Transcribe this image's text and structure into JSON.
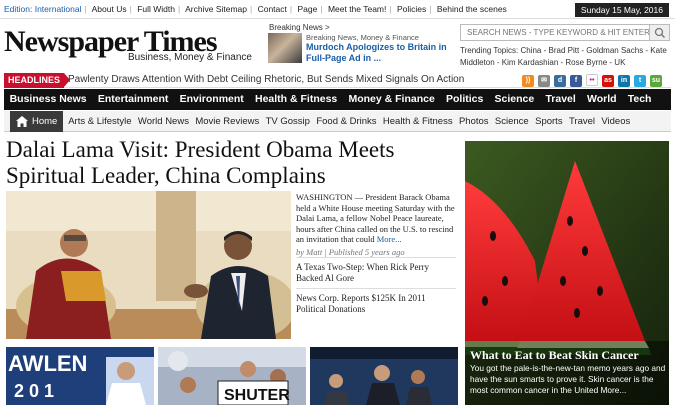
{
  "topbar": {
    "edition": "Edition: International",
    "links": [
      "About Us",
      "Full Width",
      "Archive Sitemap",
      "Contact",
      "Page",
      "Meet the Team!",
      "Policies",
      "Behind the scenes"
    ],
    "date": "Sunday 15 May, 2016"
  },
  "brand": {
    "logo": "Newspaper Times",
    "tagline": "Business, Money & Finance"
  },
  "breaking": {
    "label": "Breaking News >",
    "categories": "Breaking News, Money & Finance",
    "title": "Murdoch Apologizes to Britain in Full-Page Ad in ..."
  },
  "search": {
    "placeholder": "SEARCH NEWS - TYPE KEYWORD & HIT ENTER"
  },
  "trending": {
    "text": "Trending Topics: China - Brad Pitt - Goldman Sachs - Kate Middleton - Kim Kardashian - Rose Byrne - UK"
  },
  "ticker": {
    "label": "HEADLINES",
    "text": "Pawlenty Draws Attention With Debt Ceiling Rhetoric, But Sends Mixed Signals On Action"
  },
  "social": [
    {
      "icon": "rss-icon",
      "glyph": "))",
      "color": "#f08a24"
    },
    {
      "icon": "mail-icon",
      "glyph": "✉",
      "color": "#888888"
    },
    {
      "icon": "digg-icon",
      "glyph": "d",
      "color": "#3b6d9a"
    },
    {
      "icon": "facebook-icon",
      "glyph": "f",
      "color": "#3b5998"
    },
    {
      "icon": "flickr-icon",
      "glyph": "••",
      "color": "#ffffff"
    },
    {
      "icon": "lastfm-icon",
      "glyph": "as",
      "color": "#d51007"
    },
    {
      "icon": "linkedin-icon",
      "glyph": "in",
      "color": "#0e76a8"
    },
    {
      "icon": "twitter-icon",
      "glyph": "t",
      "color": "#2aa9e0"
    },
    {
      "icon": "stumbleupon-icon",
      "glyph": "su",
      "color": "#5ba83a"
    }
  ],
  "main_nav": [
    "Business News",
    "Entertainment",
    "Environment",
    "Health & Fitness",
    "Money & Finance",
    "Politics",
    "Science",
    "Travel",
    "World",
    "Tech"
  ],
  "sub_nav": {
    "home": "Home",
    "items": [
      "Arts & Lifestyle",
      "World News",
      "Movie Reviews",
      "TV Gossip",
      "Food & Drinks",
      "Health & Fitness",
      "Photos",
      "Science",
      "Sports",
      "Travel",
      "Videos"
    ]
  },
  "article": {
    "headline": "Dalai Lama Visit: President Obama Meets Spiritual Leader, China Complains",
    "lede": "WASHINGTON — President Barack Obama held a White House meeting Saturday with the Dalai Lama, a fellow Nobel Peace laureate, hours after China called on the U.S. to rescind an invitation that could",
    "more": "More...",
    "byline": "by Matt | Published 5 years ago"
  },
  "related": [
    "A Texas Two-Step: When Rick Perry Backed Al Gore",
    "News Corp. Reports $125K In 2011 Political Donations"
  ],
  "feature": {
    "title": "What to Eat to Beat Skin Cancer",
    "desc": "You got the pale-is-the-new-tan memo years ago and have the sun smarts to prove it. Skin cancer is the most common cancer in the United More..."
  },
  "bottom": {
    "thumb1_text": "AWLEN",
    "thumb1_sub": "2 0 1",
    "thumb2_text": "SHUTER"
  },
  "colors": {
    "accent_red": "#c8102e",
    "link_blue": "#1a5ea8",
    "nav_black": "#111111"
  }
}
